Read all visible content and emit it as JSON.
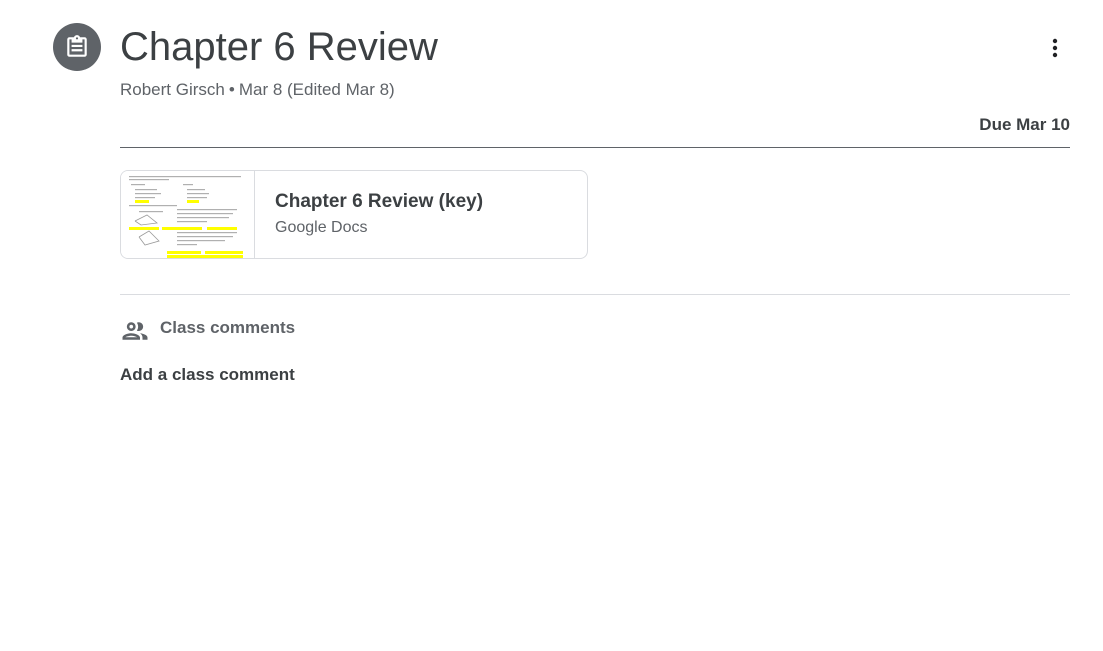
{
  "assignment": {
    "type_icon": "assignment-icon",
    "title": "Chapter 6 Review",
    "author": "Robert Girsch",
    "separator": "•",
    "posted": "Mar 8 (Edited Mar 8)",
    "due": "Due Mar 10",
    "more_icon": "more-vert-icon"
  },
  "attachment": {
    "title": "Chapter 6 Review (key)",
    "source": "Google Docs"
  },
  "comments": {
    "icon": "people-icon",
    "label": "Class comments",
    "add_label": "Add a class comment"
  },
  "colors": {
    "icon_bg": "#5f6368",
    "text": "#3c4043",
    "muted": "#5f6368",
    "border": "#dadce0",
    "highlight": "#ffff00"
  }
}
